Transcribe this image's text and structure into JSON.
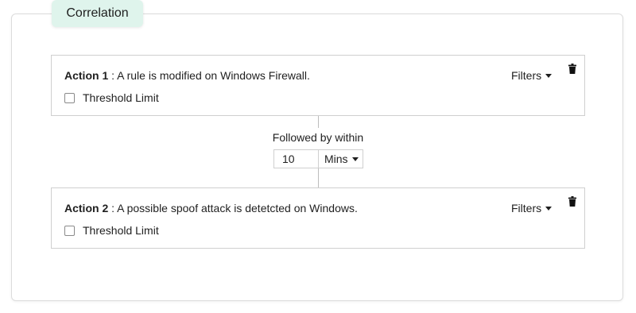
{
  "tab": {
    "label": "Correlation"
  },
  "actions": [
    {
      "name": "Action 1",
      "separator": " : ",
      "description": "A rule is modified on Windows Firewall.",
      "threshold_label": "Threshold Limit",
      "threshold_checked": false,
      "filters_label": "Filters"
    },
    {
      "name": "Action 2",
      "separator": " : ",
      "description": "A possible spoof attack is detetcted on Windows.",
      "threshold_label": "Threshold Limit",
      "threshold_checked": false,
      "filters_label": "Filters"
    }
  ],
  "connector": {
    "label": "Followed by within",
    "time_value": "10",
    "unit_selected": "Mins"
  },
  "icons": {
    "delete": "trash-icon",
    "dropdown": "caret-down-icon"
  },
  "colors": {
    "tab_background": "#dff4ec",
    "border": "#cfcfcf"
  }
}
